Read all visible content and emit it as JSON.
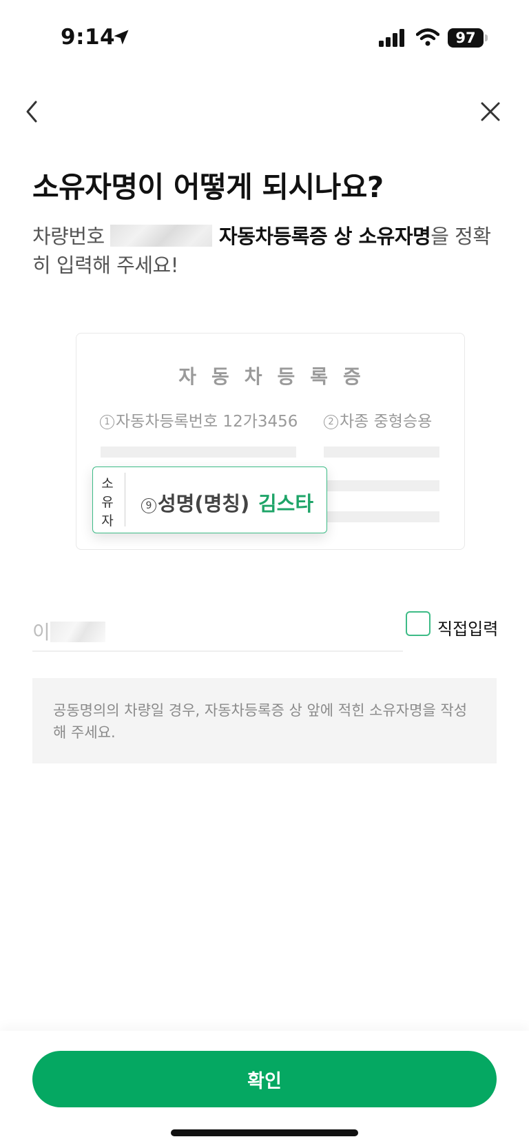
{
  "status_bar": {
    "time": "9:14",
    "battery": "97",
    "icons": [
      "location-arrow-icon",
      "cellular-signal-icon",
      "wifi-icon",
      "battery-icon"
    ]
  },
  "nav": {
    "back_icon": "chevron-left-icon",
    "close_icon": "close-icon"
  },
  "title": "소유자명이 어떻게 되시나요?",
  "description": {
    "prefix": "차량번호 ",
    "middle": " 자동차등록증 상 소유자명",
    "suffix": "을 정확히 입력해 주세요!"
  },
  "card": {
    "title": "자동차등록증",
    "field1_num": "1",
    "field1_text": "자동차등록번호 12가3456",
    "field2_num": "2",
    "field2_text": "차종  중형승용",
    "owner_side_label": [
      "소",
      "유",
      "자"
    ],
    "owner_field_num": "9",
    "owner_field_label": "성명(명칭)",
    "owner_example_name": "김스타"
  },
  "name_input": {
    "value": "이"
  },
  "manual_input": {
    "label": "직접입력",
    "checked": false
  },
  "notice": "공동명의의 차량일 경우, 자동차등록증 상 앞에 적힌 소유자명을 작성해 주세요.",
  "confirm_label": "확인",
  "colors": {
    "accent": "#05a862",
    "example_name": "#1ea468",
    "checkbox_border": "#3dbb86"
  }
}
